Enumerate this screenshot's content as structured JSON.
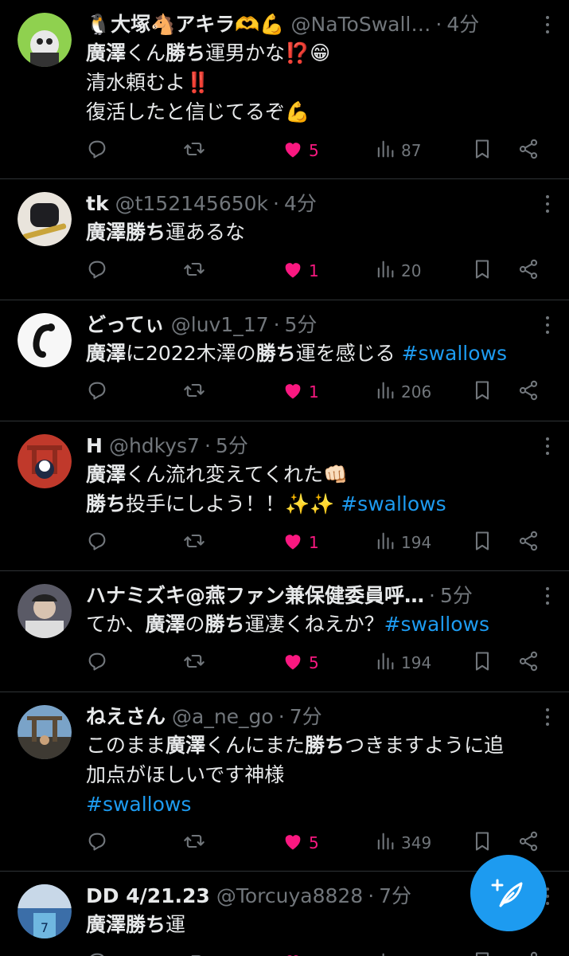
{
  "colors": {
    "background": "#000000",
    "accent": "#1d9bf0",
    "like": "#f91880",
    "muted": "#71767b"
  },
  "tweets": [
    {
      "name": "🐧大塚🐴アキラ🫶💪",
      "handle": "@NaToSwall…",
      "time": "4分",
      "lines": [
        [
          {
            "t": "廣澤",
            "b": true
          },
          {
            "t": "くん"
          },
          {
            "t": "勝ち",
            "b": true
          },
          {
            "t": "運男かな⁉️😁"
          }
        ],
        [
          {
            "t": "清水頼むよ‼️"
          }
        ],
        [
          {
            "t": "復活したと信じてるぞ💪"
          }
        ]
      ],
      "likes": "5",
      "liked": true,
      "views": "87"
    },
    {
      "name": "tk",
      "handle": "@t152145650k",
      "time": "4分",
      "lines": [
        [
          {
            "t": "廣澤勝ち",
            "b": true
          },
          {
            "t": "運あるな"
          }
        ]
      ],
      "likes": "1",
      "liked": true,
      "views": "20"
    },
    {
      "name": "どってぃ",
      "handle": "@luv1_17",
      "time": "5分",
      "lines": [
        [
          {
            "t": "廣澤",
            "b": true
          },
          {
            "t": "に2022木澤の"
          },
          {
            "t": "勝ち",
            "b": true
          },
          {
            "t": "運を感じる "
          },
          {
            "t": "#swallows",
            "tag": true
          }
        ]
      ],
      "likes": "1",
      "liked": true,
      "views": "206"
    },
    {
      "name": "H",
      "handle": "@hdkys7",
      "time": "5分",
      "lines": [
        [
          {
            "t": "廣澤",
            "b": true
          },
          {
            "t": "くん流れ変えてくれた👊🏻"
          }
        ],
        [
          {
            "t": "勝ち",
            "b": true
          },
          {
            "t": "投手にしよう！！✨✨ "
          },
          {
            "t": "#swallows",
            "tag": true
          }
        ]
      ],
      "likes": "1",
      "liked": true,
      "views": "194"
    },
    {
      "name": "ハナミズキ@燕ファン兼保健委員呼…",
      "handle": "",
      "time": "5分",
      "lines": [
        [
          {
            "t": "てか、"
          },
          {
            "t": "廣澤",
            "b": true
          },
          {
            "t": "の"
          },
          {
            "t": "勝ち",
            "b": true
          },
          {
            "t": "運凄くねえか？"
          },
          {
            "t": "#swallows",
            "tag": true
          }
        ]
      ],
      "likes": "5",
      "liked": true,
      "views": "194"
    },
    {
      "name": "ねえさん",
      "handle": "@a_ne_go",
      "time": "7分",
      "lines": [
        [
          {
            "t": "このまま"
          },
          {
            "t": "廣澤",
            "b": true
          },
          {
            "t": "くんにまた"
          },
          {
            "t": "勝ち",
            "b": true
          },
          {
            "t": "つきますように追"
          }
        ],
        [
          {
            "t": "加点がほしいです神様"
          }
        ],
        [
          {
            "t": "#swallows",
            "tag": true
          }
        ]
      ],
      "likes": "5",
      "liked": true,
      "views": "349"
    },
    {
      "name": "DD 4/21.23",
      "handle": "@Torcuya8828",
      "time": "7分",
      "lines": [
        [
          {
            "t": "廣澤勝ち",
            "b": true
          },
          {
            "t": "運"
          }
        ]
      ],
      "likes": "",
      "liked": true,
      "views": ""
    }
  ],
  "icons": {
    "reply": "reply-icon",
    "retweet": "retweet-icon",
    "like": "heart-icon",
    "views": "views-icon",
    "bookmark": "bookmark-icon",
    "share": "share-icon",
    "compose": "compose-icon",
    "more": "more-icon"
  }
}
